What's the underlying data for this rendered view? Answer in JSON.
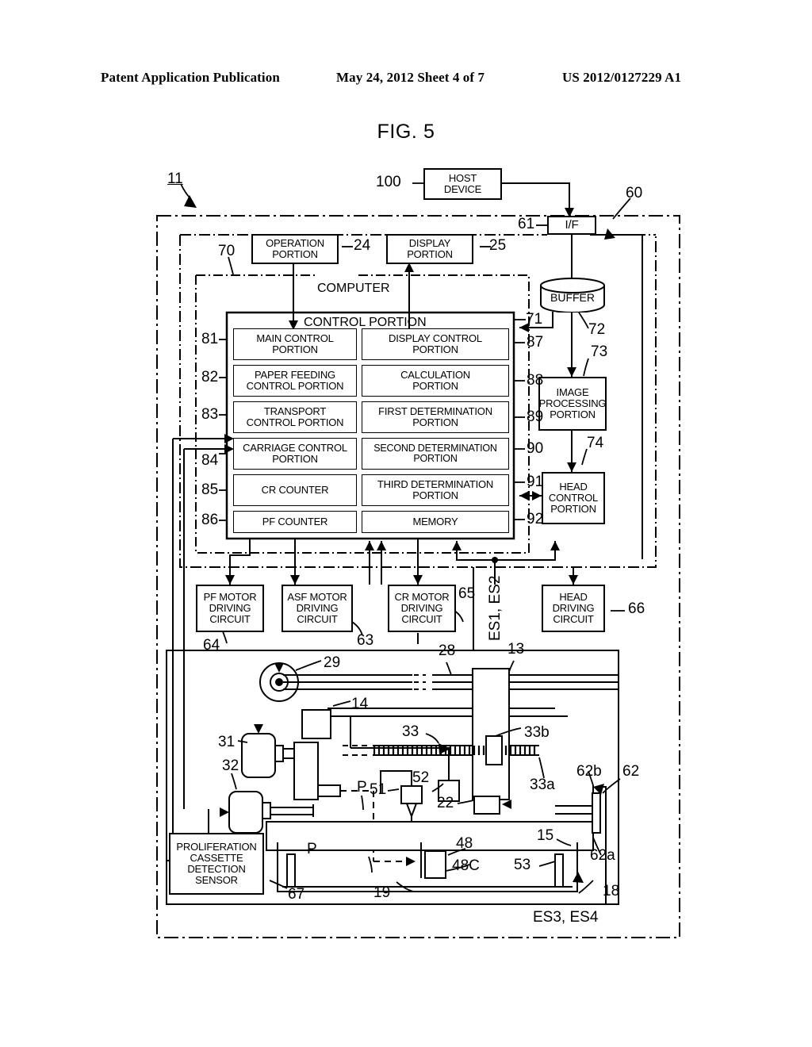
{
  "header": {
    "publication": "Patent Application Publication",
    "date_sheet": "May 24, 2012  Sheet 4 of 7",
    "patent_number": "US 2012/0127229 A1"
  },
  "figure": {
    "title": "FIG. 5"
  },
  "blocks": {
    "host_device": "HOST\nDEVICE",
    "interface": "I/F",
    "operation_portion": "OPERATION\nPORTION",
    "display_portion": "DISPLAY\nPORTION",
    "computer": "COMPUTER",
    "control_portion": "CONTROL PORTION",
    "buffer": "BUFFER",
    "image_processing_portion": "IMAGE\nPROCESSING\nPORTION",
    "head_control_portion": "HEAD\nCONTROL\nPORTION",
    "main_control_portion": "MAIN CONTROL\nPORTION",
    "display_control_portion": "DISPLAY CONTROL\nPORTION",
    "paper_feeding_control_portion": "PAPER FEEDING\nCONTROL PORTION",
    "calculation_portion": "CALCULATION\nPORTION",
    "transport_control_portion": "TRANSPORT\nCONTROL PORTION",
    "first_determination_portion": "FIRST DETERMINATION\nPORTION",
    "carriage_control_portion": "CARRIAGE CONTROL\nPORTION",
    "second_determination_portion": "SECOND DETERMINATION\nPORTION",
    "cr_counter": "CR COUNTER",
    "third_determination_portion": "THIRD DETERMINATION\nPORTION",
    "pf_counter": "PF COUNTER",
    "memory": "MEMORY",
    "pf_motor_driving_circuit": "PF MOTOR\nDRIVING\nCIRCUIT",
    "asf_motor_driving_circuit": "ASF MOTOR\nDRIVING\nCIRCUIT",
    "cr_motor_driving_circuit": "CR MOTOR\nDRIVING\nCIRCUIT",
    "head_driving_circuit": "HEAD\nDRIVING\nCIRCUIT",
    "proliferation_cassette_detection_sensor": "PROLIFERATION\nCASSETTE\nDETECTION\nSENSOR"
  },
  "reference_numerals": {
    "n11": "11",
    "n100": "100",
    "n60": "60",
    "n61": "61",
    "n70": "70",
    "n24": "24",
    "n25": "25",
    "n71": "71",
    "n72": "72",
    "n73": "73",
    "n74": "74",
    "n81": "81",
    "n82": "82",
    "n83": "83",
    "n84": "84",
    "n85": "85",
    "n86": "86",
    "n87": "87",
    "n88": "88",
    "n89": "89",
    "n90": "90",
    "n91": "91",
    "n92": "92",
    "n63": "63",
    "n64": "64",
    "n65": "65",
    "n66": "66",
    "n67": "67",
    "n29": "29",
    "n28": "28",
    "n13": "13",
    "n14": "14",
    "n31": "31",
    "n32": "32",
    "n33": "33",
    "n33a": "33a",
    "n33b": "33b",
    "n51": "51",
    "n52": "52",
    "n22": "22",
    "n48": "48",
    "n48c": "48C",
    "n53": "53",
    "n15": "15",
    "n18": "18",
    "n19": "19",
    "n62": "62",
    "n62a": "62a",
    "n62b": "62b",
    "pP1": "P",
    "pP2": "P",
    "es12": "ES1, ES2",
    "es34": "ES3, ES4"
  },
  "colors": {
    "ink": "#000000",
    "paper": "#ffffff"
  }
}
